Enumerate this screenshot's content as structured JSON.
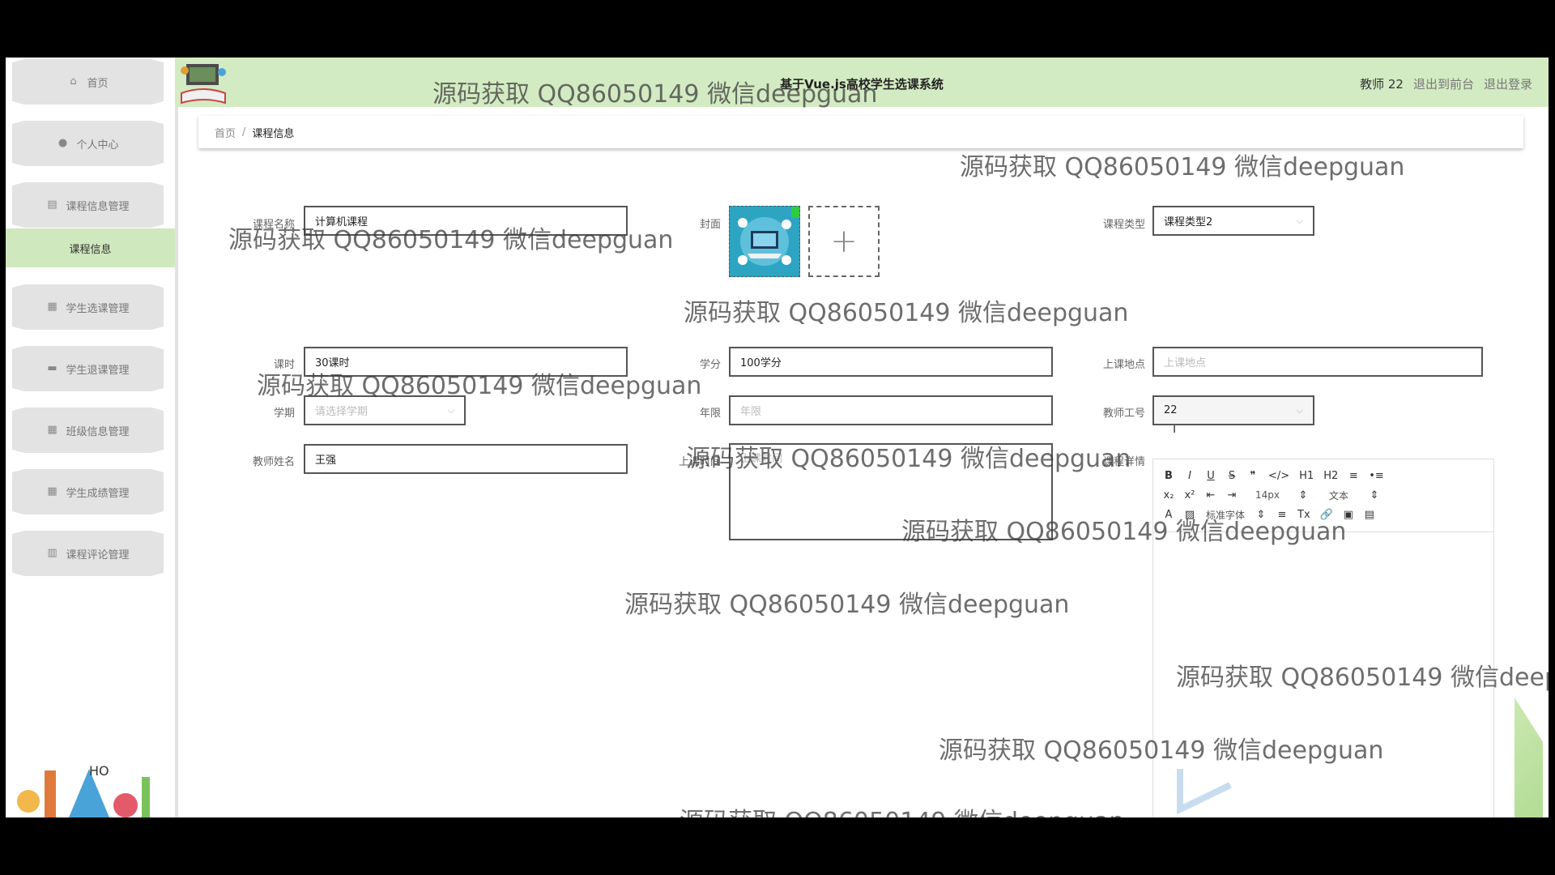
{
  "sidebar": {
    "items": [
      {
        "label": "首页",
        "icon": "home-icon"
      },
      {
        "label": "个人中心",
        "icon": "user-icon"
      },
      {
        "label": "课程信息管理",
        "icon": "clipboard-icon"
      },
      {
        "label": "学生选课管理",
        "icon": "grid-icon"
      },
      {
        "label": "学生退课管理",
        "icon": "laptop-icon"
      },
      {
        "label": "班级信息管理",
        "icon": "grid-icon"
      },
      {
        "label": "学生成绩管理",
        "icon": "grid-icon"
      },
      {
        "label": "课程评论管理",
        "icon": "chart-icon"
      }
    ],
    "active_sub": "课程信息"
  },
  "header": {
    "title": "基于Vue.js高校学生选课系统",
    "user": "教师 22",
    "link_front": "退出到前台",
    "link_logout": "退出登录"
  },
  "breadcrumb": {
    "home": "首页",
    "sep": "/",
    "current": "课程信息"
  },
  "form": {
    "course_name": {
      "label": "课程名称",
      "value": "计算机课程"
    },
    "cover": {
      "label": "封面",
      "upload_symbol": "+"
    },
    "course_type": {
      "label": "课程类型",
      "value": "课程类型2"
    },
    "hours": {
      "label": "课时",
      "value": "30课时"
    },
    "credits": {
      "label": "学分",
      "value": "100学分"
    },
    "location": {
      "label": "上课地点",
      "placeholder": "上课地点"
    },
    "semester": {
      "label": "学期",
      "placeholder": "请选择学期"
    },
    "years": {
      "label": "年限",
      "placeholder": "年限"
    },
    "teacher_id": {
      "label": "教师工号",
      "value": "22"
    },
    "teacher_name": {
      "label": "教师姓名",
      "value": "王强"
    },
    "class_time": {
      "label": "上课时间",
      "placeholder": "上课时间"
    },
    "details": {
      "label": "课程详情"
    }
  },
  "editor": {
    "row1": [
      "B",
      "I",
      "U",
      "S",
      "❞",
      "</>",
      "H1",
      "H2",
      "≡",
      "•≡"
    ],
    "row2": [
      "x₂",
      "x²",
      "⇤",
      "⇥",
      "14px",
      "⇕",
      "文本",
      "⇕"
    ],
    "row3": [
      "A",
      "▨",
      "标准字体",
      "⇕",
      "≡",
      "Tx",
      "🔗",
      "▣",
      "▤"
    ]
  },
  "watermark": "源码获取 QQ86050149 微信deepguan"
}
